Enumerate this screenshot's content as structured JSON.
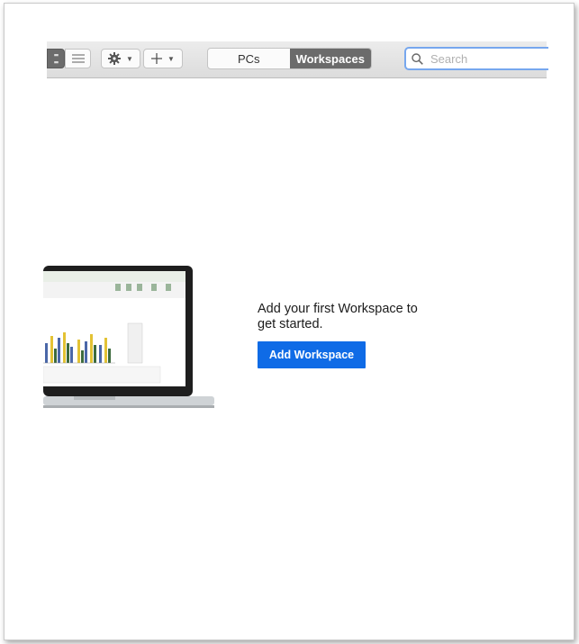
{
  "toolbar": {
    "view_tabs": [
      {
        "label": "PCs",
        "active": false
      },
      {
        "label": "Workspaces",
        "active": true
      }
    ],
    "search": {
      "placeholder": "Search",
      "value": ""
    },
    "icons": [
      "grid-view-icon",
      "list-view-icon",
      "gear-icon",
      "chevron-down-icon",
      "plus-icon"
    ]
  },
  "empty_state": {
    "message": "Add your first Workspace to get started.",
    "button_label": "Add Workspace"
  },
  "colors": {
    "accent": "#0f6be6",
    "segment_active": "#6b6b6b",
    "search_focus": "#77a7ee"
  }
}
